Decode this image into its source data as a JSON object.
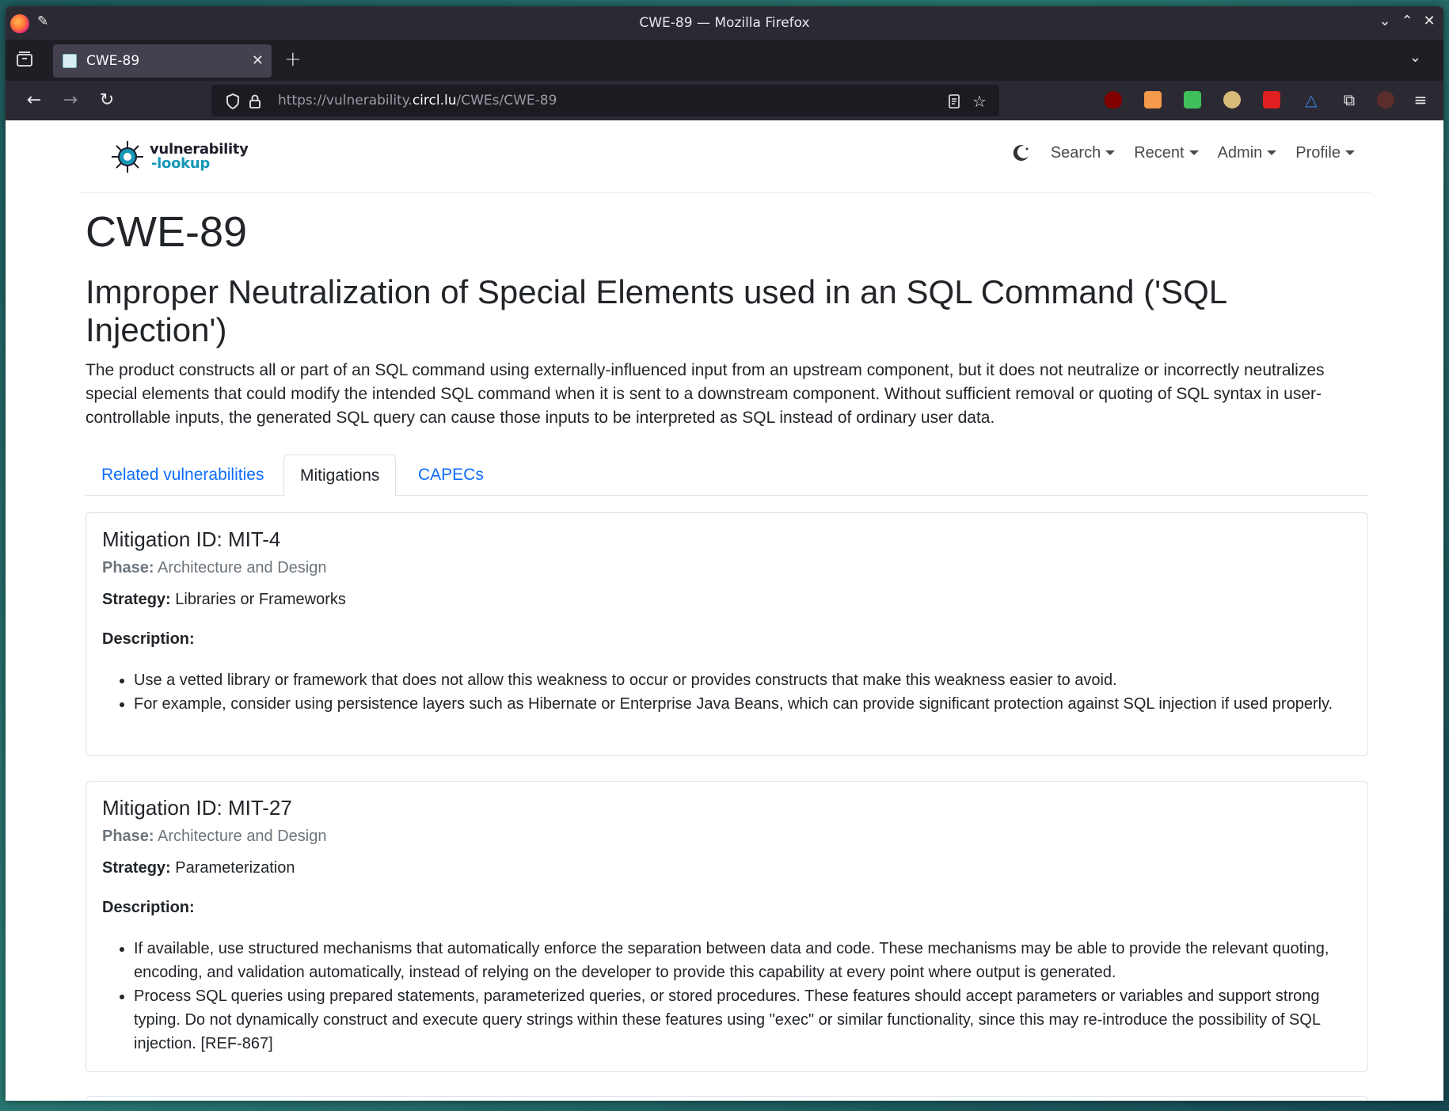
{
  "window": {
    "title": "CWE-89 — Mozilla Firefox"
  },
  "browser": {
    "tab_label": "CWE-89",
    "url_prefix": "https://vulnerability.",
    "url_domain": "circl.lu",
    "url_path": "/CWEs/CWE-89"
  },
  "site": {
    "logo_line1": "vulnerability",
    "logo_line2": "-lookup",
    "menu": {
      "search": "Search",
      "recent": "Recent",
      "admin": "Admin",
      "profile": "Profile"
    }
  },
  "cwe": {
    "id": "CWE-89",
    "name": "Improper Neutralization of Special Elements used in an SQL Command ('SQL Injection')",
    "description": "The product constructs all or part of an SQL command using externally-influenced input from an upstream component, but it does not neutralize or incorrectly neutralizes special elements that could modify the intended SQL command when it is sent to a downstream component. Without sufficient removal or quoting of SQL syntax in user-controllable inputs, the generated SQL query can cause those inputs to be interpreted as SQL instead of ordinary user data."
  },
  "tabs": {
    "related": "Related vulnerabilities",
    "mitigations": "Mitigations",
    "capecs": "CAPECs"
  },
  "labels": {
    "phase": "Phase:",
    "strategy": "Strategy:",
    "description": "Description:"
  },
  "mitigations": [
    {
      "title": "Mitigation ID: MIT-4",
      "phase": "Architecture and Design",
      "strategy": "Libraries or Frameworks",
      "items": [
        "Use a vetted library or framework that does not allow this weakness to occur or provides constructs that make this weakness easier to avoid.",
        "For example, consider using persistence layers such as Hibernate or Enterprise Java Beans, which can provide significant protection against SQL injection if used properly."
      ]
    },
    {
      "title": "Mitigation ID: MIT-27",
      "phase": "Architecture and Design",
      "strategy": "Parameterization",
      "items": [
        "If available, use structured mechanisms that automatically enforce the separation between data and code. These mechanisms may be able to provide the relevant quoting, encoding, and validation automatically, instead of relying on the developer to provide this capability at every point where output is generated.",
        "Process SQL queries using prepared statements, parameterized queries, or stored procedures. These features should accept parameters or variables and support strong typing. Do not dynamically construct and execute query strings within these features using \"exec\" or similar functionality, since this may re-introduce the possibility of SQL injection. [REF-867]"
      ]
    }
  ]
}
